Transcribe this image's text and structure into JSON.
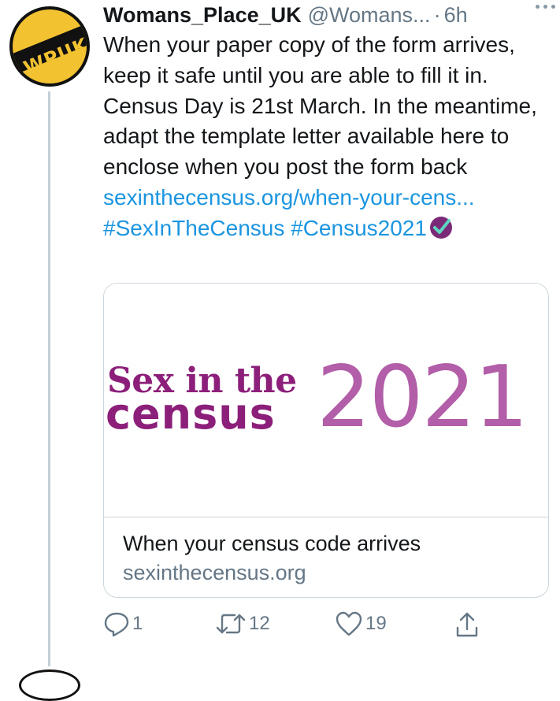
{
  "avatar": {
    "logo_text": "WPUK"
  },
  "header": {
    "display_name": "Womans_Place_UK",
    "handle": "@Womans...",
    "separator": "·",
    "time": "6h",
    "more_icon": "more-dots-icon"
  },
  "tweet": {
    "text_plain": "When your paper copy of the form arrives, keep it safe until you are able to fill it in. Census Day is 21st March. In the meantime, adapt the template letter available here to enclose when you post the form back ",
    "link": "sexinthecensus.org/when-your-cens...",
    "hashtag1": "#SexInTheCensus",
    "hashtag2": "#Census2021",
    "badge_icon": "checkmark-badge-icon"
  },
  "card": {
    "logo_line1": "Sex in the",
    "logo_line2": "census",
    "logo_year": "2021",
    "title": "When your census code arrives",
    "domain": "sexinthecensus.org"
  },
  "actions": {
    "reply": {
      "icon": "reply-icon",
      "count": "1"
    },
    "retweet": {
      "icon": "retweet-icon",
      "count": "12"
    },
    "like": {
      "icon": "heart-icon",
      "count": "19"
    },
    "share": {
      "icon": "share-icon"
    }
  },
  "colors": {
    "link": "#1b95e0",
    "secondary_text": "#657786",
    "logo_dark_purple": "#8c1f7a",
    "logo_light_purple": "#b25ea8",
    "avatar_yellow": "#f2c230"
  }
}
